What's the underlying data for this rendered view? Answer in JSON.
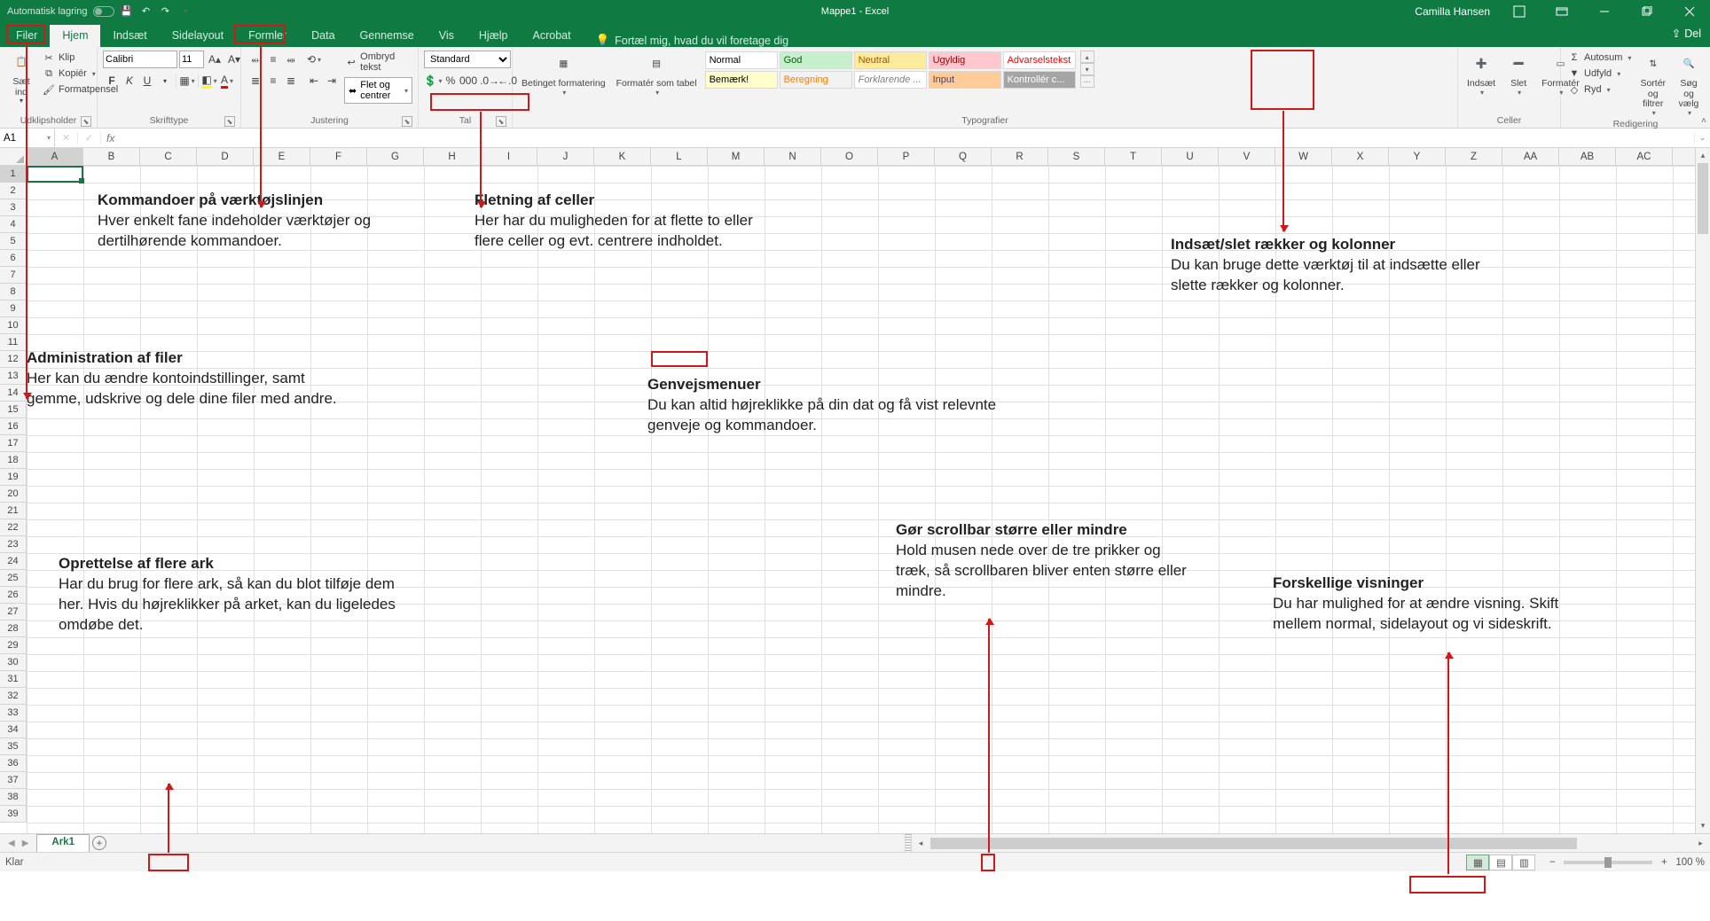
{
  "titlebar": {
    "autosave_label": "Automatisk lagring",
    "doc_title": "Mappe1 - Excel",
    "user_name": "Camilla Hansen"
  },
  "tabs": {
    "filer": "Filer",
    "hjem": "Hjem",
    "indsaet": "Indsæt",
    "sidelayout": "Sidelayout",
    "formler": "Formler",
    "data": "Data",
    "gennemse": "Gennemse",
    "vis": "Vis",
    "hjaelp": "Hjælp",
    "acrobat": "Acrobat",
    "tellme": "Fortæl mig, hvad du vil foretage dig",
    "share": "Del"
  },
  "ribbon": {
    "clipboard": {
      "label": "Udklipsholder",
      "paste": "Sæt ind",
      "cut": "Klip",
      "copy": "Kopiér",
      "format_painter": "Formatpensel"
    },
    "font": {
      "label": "Skrifttype",
      "name": "Calibri",
      "size": "11"
    },
    "alignment": {
      "label": "Justering",
      "wrap": "Ombryd tekst",
      "merge": "Flet og centrer"
    },
    "number": {
      "label": "Tal",
      "format": "Standard"
    },
    "styles": {
      "label": "Typografier",
      "cond": "Betinget formatering",
      "table": "Formatér som tabel",
      "list": [
        {
          "text": "Normal",
          "bg": "#ffffff",
          "color": "#000"
        },
        {
          "text": "God",
          "bg": "#c6efce",
          "color": "#006100"
        },
        {
          "text": "Neutral",
          "bg": "#ffeb9c",
          "color": "#9c5700"
        },
        {
          "text": "Ugyldig",
          "bg": "#ffc7ce",
          "color": "#9c0006"
        },
        {
          "text": "Advarselstekst",
          "bg": "#ffffff",
          "color": "#ff0000"
        },
        {
          "text": "Bemærk!",
          "bg": "#ffffcc",
          "color": "#000"
        },
        {
          "text": "Beregning",
          "bg": "#f2f2f2",
          "color": "#fa7d00"
        },
        {
          "text": "Forklarende ...",
          "bg": "#ffffff",
          "color": "#7f7f7f"
        },
        {
          "text": "Input",
          "bg": "#ffcc99",
          "color": "#3f3f76"
        },
        {
          "text": "Kontrollér c...",
          "bg": "#a5a5a5",
          "color": "#ffffff"
        }
      ]
    },
    "cells": {
      "label": "Celler",
      "insert": "Indsæt",
      "delete": "Slet",
      "format": "Formatér"
    },
    "editing": {
      "label": "Redigering",
      "autosum": "Autosum",
      "fill": "Udfyld",
      "clear": "Ryd",
      "sort": "Sortér og filtrer",
      "find": "Søg og vælg"
    }
  },
  "formula_bar": {
    "cell_ref": "A1"
  },
  "grid": {
    "columns": [
      "A",
      "B",
      "C",
      "D",
      "E",
      "F",
      "G",
      "H",
      "I",
      "J",
      "K",
      "L",
      "M",
      "N",
      "O",
      "P",
      "Q",
      "R",
      "S",
      "T",
      "U",
      "V",
      "W",
      "X",
      "Y",
      "Z",
      "AA",
      "AB",
      "AC"
    ],
    "rows_visible": 39
  },
  "sheets": {
    "tab1": "Ark1"
  },
  "status": {
    "ready": "Klar",
    "zoom": "100 %"
  },
  "annotations": {
    "a1": {
      "title": "Kommandoer på værktøjslinjen",
      "body": "Hver enkelt fane indeholder værktøjer og dertilhørende kommandoer."
    },
    "a2": {
      "title": "Fletning af celler",
      "body": "Her har du muligheden for at flette to eller flere celler og evt. centrere indholdet."
    },
    "a3": {
      "title": "Indsæt/slet rækker og kolonner",
      "body": "Du kan bruge dette værktøj til at indsætte eller slette rækker og kolonner."
    },
    "a4": {
      "title": "Administration af filer",
      "body": "Her kan du ændre kontoindstillinger, samt gemme, udskrive og dele dine filer med andre."
    },
    "a5": {
      "title": "Genvejsmenuer",
      "body": "Du kan altid højreklikke på din dat og få vist relevnte genveje og kommandoer."
    },
    "a6": {
      "title": "Oprettelse af flere ark",
      "body": "Har du brug for flere ark, så kan du blot tilføje dem her. Hvis du højreklikker på arket, kan du ligeledes omdøbe det."
    },
    "a7": {
      "title": "Gør scrollbar større eller mindre",
      "body": "Hold musen nede over de tre prikker og træk, så scrollbaren bliver enten større eller mindre."
    },
    "a8": {
      "title": "Forskellige visninger",
      "body": "Du har mulighed for at ændre visning. Skift mellem normal, sidelayout og vi sideskrift."
    }
  }
}
